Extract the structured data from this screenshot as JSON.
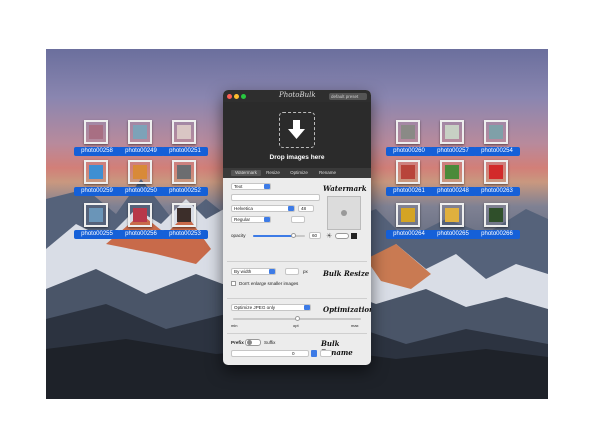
{
  "app": {
    "title": "PhotoBulk",
    "preset": "default preset"
  },
  "drop": {
    "label": "Drop images here"
  },
  "tabs": [
    "Watermark",
    "Resize",
    "Optimize",
    "Rename"
  ],
  "watermark": {
    "heading": "Watermark",
    "type": "Text",
    "text_value": "",
    "font": "Helvetica",
    "style": "Regular",
    "size": "48",
    "opacity_label": "opacity",
    "opacity_value": "60",
    "opacity_fraction": 0.78
  },
  "resize": {
    "heading": "Bulk Resize",
    "mode": "By width",
    "px_value": "",
    "px_unit": "px",
    "dont_enlarge": "Don't enlarge smaller images"
  },
  "optimization": {
    "heading": "Optimization",
    "mode": "Optimize JPEG only",
    "min": "min",
    "opt": "opt",
    "max": "max",
    "level_fraction": 0.5
  },
  "rename": {
    "heading": "Bulk Rename",
    "prefix": "Prefix",
    "suffix": "Suffix",
    "start": "0"
  },
  "desktop_icons": [
    {
      "label": "photo00258",
      "color": "#a86f83"
    },
    {
      "label": "photo00249",
      "color": "#7da2b8"
    },
    {
      "label": "photo00251",
      "color": "#d9c6c4"
    },
    {
      "label": "photo00259",
      "color": "#3f8fd2"
    },
    {
      "label": "photo00250",
      "color": "#d88a38"
    },
    {
      "label": "photo00252",
      "color": "#6c6d70"
    },
    {
      "label": "photo00255",
      "color": "#6a95b8"
    },
    {
      "label": "photo00256",
      "color": "#b8384a"
    },
    {
      "label": "photo00253",
      "color": "#3c2e2a"
    },
    {
      "label": "photo00260",
      "color": "#8a8a86"
    },
    {
      "label": "photo00257",
      "color": "#c7d0c4"
    },
    {
      "label": "photo00254",
      "color": "#7fa0a8"
    },
    {
      "label": "photo00261",
      "color": "#b8443a"
    },
    {
      "label": "photo00248",
      "color": "#4b8a3a"
    },
    {
      "label": "photo00263",
      "color": "#d22a2a"
    },
    {
      "label": "photo00264",
      "color": "#d4a424"
    },
    {
      "label": "photo00265",
      "color": "#e0b03e"
    },
    {
      "label": "photo00266",
      "color": "#2f4f2a"
    }
  ]
}
